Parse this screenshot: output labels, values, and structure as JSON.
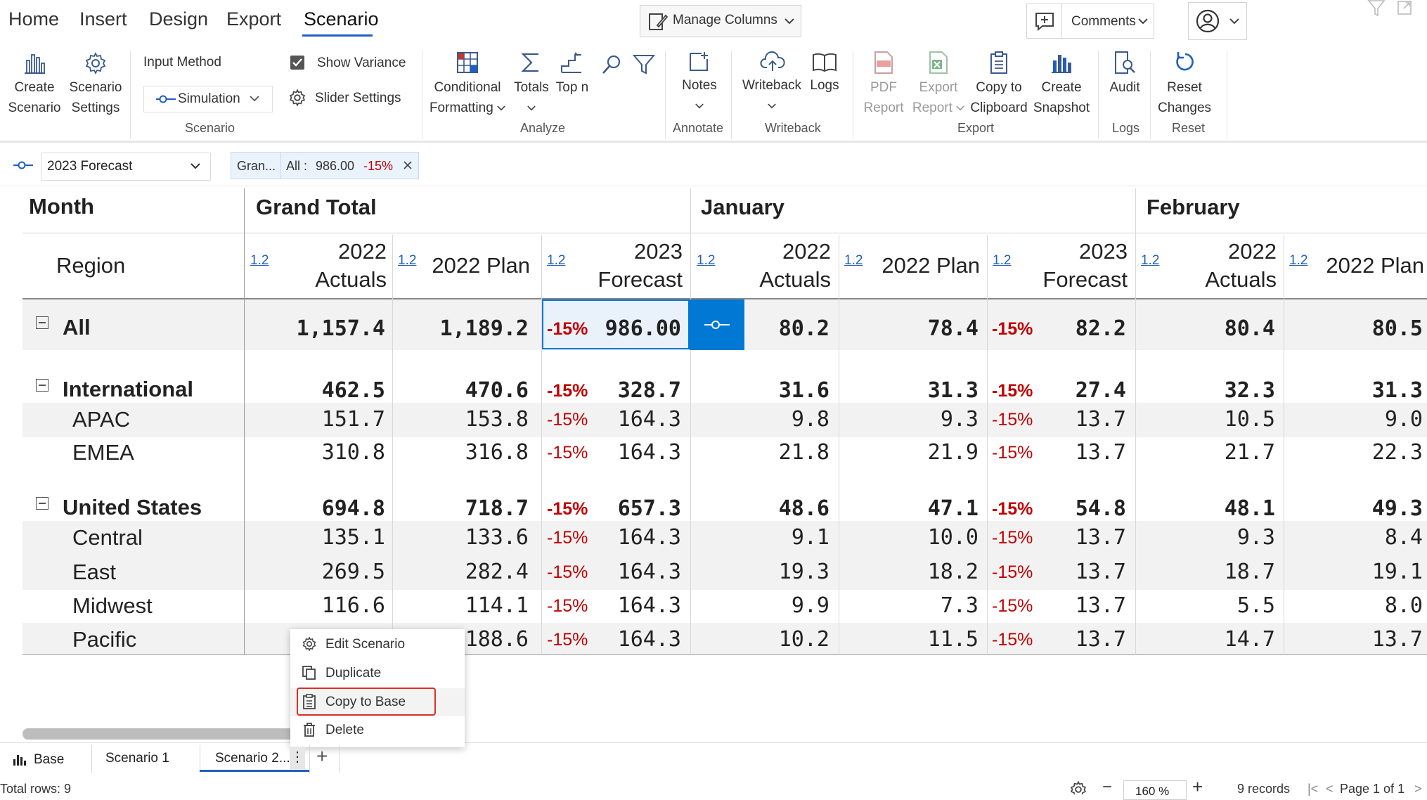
{
  "nav": {
    "tabs": [
      "Home",
      "Insert",
      "Design",
      "Export",
      "Scenario"
    ],
    "active_tab": "Scenario"
  },
  "topbar": {
    "manage_columns": "Manage Columns",
    "comments": "Comments"
  },
  "ribbon": {
    "create_scenario": [
      "Create",
      "Scenario"
    ],
    "scenario_settings": [
      "Scenario",
      "Settings"
    ],
    "input_method_label": "Input Method",
    "input_method_value": "Simulation",
    "show_variance": "Show Variance",
    "show_variance_checked": true,
    "slider_settings": "Slider Settings",
    "group_scenario": "Scenario",
    "conditional_formatting": [
      "Conditional",
      "Formatting"
    ],
    "totals": "Totals",
    "top_n": "Top n",
    "group_analyze": "Analyze",
    "notes": "Notes",
    "group_annotate": "Annotate",
    "writeback": "Writeback",
    "logs": "Logs",
    "group_writeback": "Writeback",
    "pdf_report": [
      "PDF",
      "Report"
    ],
    "export_report": [
      "Export",
      "Report"
    ],
    "copy_to_clipboard": [
      "Copy to",
      "Clipboard"
    ],
    "create_snapshot": [
      "Create",
      "Snapshot"
    ],
    "group_export": "Export",
    "audit": "Audit",
    "group_logs": "Logs",
    "reset_changes": [
      "Reset",
      "Changes"
    ],
    "group_reset": "Reset"
  },
  "filterbar": {
    "scenario_dropdown": "2023 Forecast",
    "chip_name": "Gran...",
    "chip_all": "All :",
    "chip_value": "986.00",
    "chip_var": "-15%"
  },
  "grid": {
    "row_header": "Month",
    "region_header": "Region",
    "groups": [
      "Grand Total",
      "January",
      "February"
    ],
    "col_icon": "1.2",
    "columns": [
      [
        "2022",
        "Actuals"
      ],
      [
        "2022 Plan"
      ],
      [
        "2023",
        "Forecast"
      ],
      [
        "2022",
        "Actuals"
      ],
      [
        "2022 Plan"
      ],
      [
        "2023",
        "Forecast"
      ],
      [
        "2022",
        "Actuals"
      ],
      [
        "2022 Plan"
      ]
    ],
    "rows": [
      {
        "label": "All",
        "level": 0,
        "bold": true,
        "v": [
          "1,157.4",
          "1,189.2",
          "-15%",
          "986.00",
          "80.2",
          "78.4",
          "-15%",
          "82.2",
          "80.4",
          "80.5"
        ]
      },
      {
        "label": "International",
        "level": 0,
        "bold": true,
        "v": [
          "462.5",
          "470.6",
          "-15%",
          "328.7",
          "31.6",
          "31.3",
          "-15%",
          "27.4",
          "32.3",
          "31.3"
        ]
      },
      {
        "label": "APAC",
        "level": 1,
        "bold": false,
        "v": [
          "151.7",
          "153.8",
          "-15%",
          "164.3",
          "9.8",
          "9.3",
          "-15%",
          "13.7",
          "10.5",
          "9.0"
        ]
      },
      {
        "label": "EMEA",
        "level": 1,
        "bold": false,
        "v": [
          "310.8",
          "316.8",
          "-15%",
          "164.3",
          "21.8",
          "21.9",
          "-15%",
          "13.7",
          "21.7",
          "22.3"
        ]
      },
      {
        "label": "United States",
        "level": 0,
        "bold": true,
        "v": [
          "694.8",
          "718.7",
          "-15%",
          "657.3",
          "48.6",
          "47.1",
          "-15%",
          "54.8",
          "48.1",
          "49.3"
        ]
      },
      {
        "label": "Central",
        "level": 1,
        "bold": false,
        "v": [
          "135.1",
          "133.6",
          "-15%",
          "164.3",
          "9.1",
          "10.0",
          "-15%",
          "13.7",
          "9.3",
          "8.4"
        ]
      },
      {
        "label": "East",
        "level": 1,
        "bold": false,
        "v": [
          "269.5",
          "282.4",
          "-15%",
          "164.3",
          "19.3",
          "18.2",
          "-15%",
          "13.7",
          "18.7",
          "19.1"
        ]
      },
      {
        "label": "Midwest",
        "level": 1,
        "bold": false,
        "v": [
          "116.6",
          "114.1",
          "-15%",
          "164.3",
          "9.9",
          "7.3",
          "-15%",
          "13.7",
          "5.5",
          "8.0"
        ]
      },
      {
        "label": "Pacific",
        "level": 1,
        "bold": false,
        "v": [
          "",
          "188.6",
          "-15%",
          "164.3",
          "10.2",
          "11.5",
          "-15%",
          "13.7",
          "14.7",
          "13.7"
        ]
      }
    ]
  },
  "context_menu": {
    "items": [
      "Edit Scenario",
      "Duplicate",
      "Copy to Base",
      "Delete"
    ],
    "highlighted": "Copy to Base"
  },
  "sheet_tabs": {
    "base": "Base",
    "scenario1": "Scenario 1",
    "scenario2": "Scenario 2...",
    "add": "+"
  },
  "status": {
    "total_rows": "Total rows: 9",
    "zoom": "160 %",
    "records": "9 records",
    "page": "Page 1 of 1"
  },
  "colors": {
    "accent": "#1f5fbf",
    "selected": "#0078d4",
    "negative": "#c00000",
    "highlight_border": "#d93025"
  }
}
